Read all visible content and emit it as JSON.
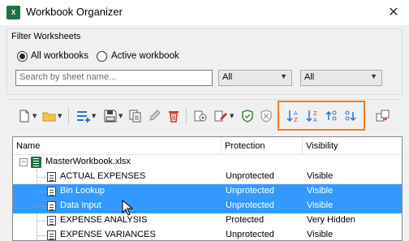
{
  "window": {
    "title": "Workbook Organizer",
    "app_icon_text": "X",
    "close_glyph": "✕"
  },
  "filter": {
    "group_title": "Filter Worksheets",
    "scope_options": [
      {
        "label": "All workbooks",
        "checked": true
      },
      {
        "label": "Active workbook",
        "checked": false
      }
    ],
    "search_placeholder": "Search by sheet name...",
    "protection_filter": "All",
    "visibility_filter": "All"
  },
  "toolbar": {
    "icons": [
      "new-sheet-icon",
      "open-folder-icon",
      "insert-icon",
      "save-icon",
      "copy-icon",
      "rename-icon",
      "delete-icon",
      "print-preview-icon",
      "protect-icon",
      "shield-check-icon",
      "shield-x-icon",
      "sort-ascending-icon",
      "sort-descending-icon",
      "move-up-icon",
      "move-down-icon",
      "switch-icon"
    ],
    "highlight_color": "#ef7d22"
  },
  "list": {
    "columns": [
      "Name",
      "Protection",
      "Visibility"
    ],
    "workbook": "MasterWorkbook.xlsx",
    "rows": [
      {
        "name": "ACTUAL EXPENSES",
        "protection": "Unprotected",
        "visibility": "Visible",
        "selected": false
      },
      {
        "name": "Bin Lookup",
        "protection": "Unprotected",
        "visibility": "Visible",
        "selected": true
      },
      {
        "name": "Data Input",
        "protection": "Unprotected",
        "visibility": "Visible",
        "selected": true
      },
      {
        "name": "EXPENSE ANALYSIS",
        "protection": "Protected",
        "visibility": "Very Hidden",
        "selected": false
      },
      {
        "name": "EXPENSE VARIANCES",
        "protection": "Unprotected",
        "visibility": "Visible",
        "selected": false
      }
    ],
    "selection_color": "#3399ff"
  }
}
